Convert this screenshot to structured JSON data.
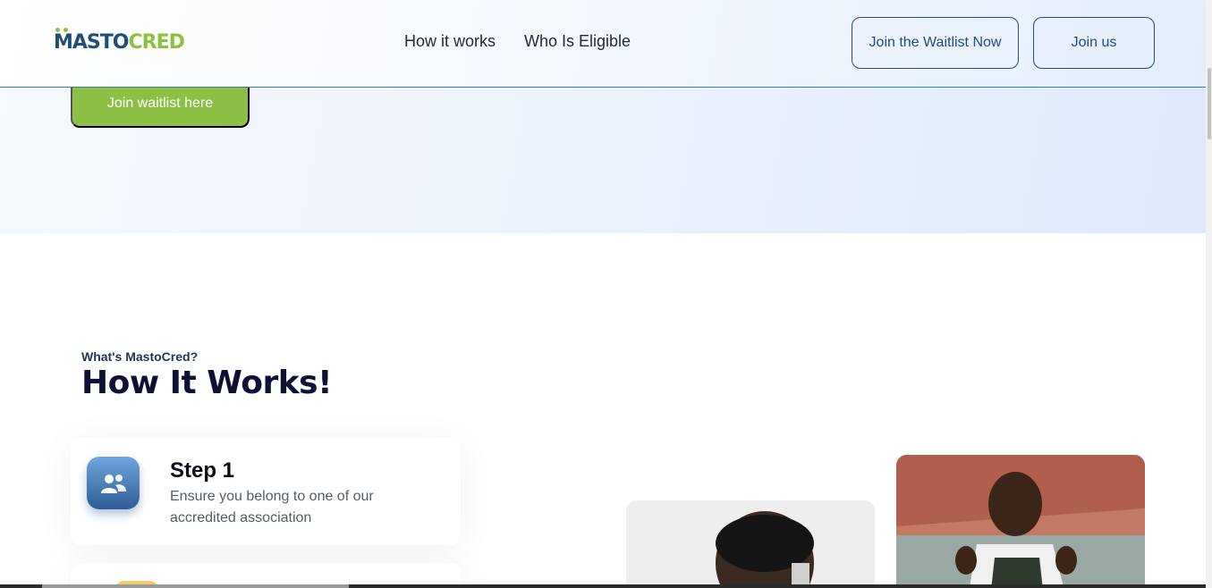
{
  "brand": {
    "logo_part1": "MASTO",
    "logo_part2": "CRED",
    "logo_accent": "#8dc13e",
    "logo_primary": "#1d4f7a"
  },
  "nav": {
    "links": [
      "How it works",
      "Who Is Eligible"
    ],
    "waitlist_button": "Join the Waitlist Now",
    "join_button": "Join us"
  },
  "hero": {
    "cta_label": "Join waitlist here",
    "cta_color": "#8dbf45"
  },
  "how_it_works": {
    "eyebrow": "What's MastoCred?",
    "title": "How It Works!",
    "steps": [
      {
        "title": "Step 1",
        "description": "Ensure you belong to one of our accredited association",
        "icon": "users-icon"
      }
    ]
  },
  "colors": {
    "navy": "#0f1035",
    "border": "#2f7fa8"
  }
}
